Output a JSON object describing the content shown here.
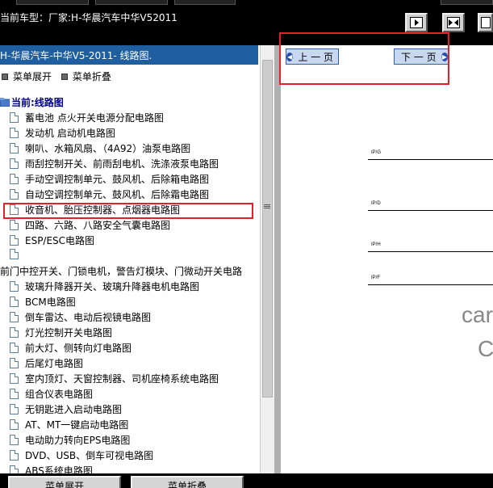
{
  "header": {
    "current_car": "当前车型：厂家:H-华晨汽车中华V52011"
  },
  "left_panel": {
    "title": "H-华晨汽车-中华V5-2011- 线路图.",
    "expand_label": "菜单展开",
    "collapse_label": "菜单折叠",
    "root_label": "当前:线路图",
    "items": [
      "蓄电池 点火开关电源分配电路图",
      "发动机 启动机电路图",
      "喇叭、水箱风扇、（4A92）油泵电路图",
      "雨刮控制开关、前雨刮电机、洗涤液泵电路图",
      "手动空调控制单元、鼓风机、后除箱电路图",
      "自动空调控制单元、鼓风机、后除霜电路图",
      "收音机、胎压控制器、点烟器电路图",
      "四路、六路、八路安全气囊电路图",
      "ESP/ESC电路图",
      "",
      "前门中控开关、门锁电机，警告灯模块、门微动开关电路",
      "玻璃升降器开关、玻璃升降器电机电路图",
      "BCM电路图",
      "倒车雷达、电动后视镜电路图",
      "灯光控制开关电路图",
      "前大灯、侧转向灯电路图",
      "后尾灯电路图",
      "室内顶灯、天窗控制器、司机座椅系统电路图",
      "组合仪表电路图",
      "无钥匙进入启动电路图",
      "AT、MT一键启动电路图",
      "电动助力转向EPS电路图",
      "DVD、USB、倒车可视电路图",
      "ABS系统电路图"
    ],
    "highlighted_index": 3
  },
  "right_panel": {
    "prev_label": "上 一 页",
    "next_label": "下 一 页",
    "pins": [
      "IP/G",
      "IP/D",
      "IP/H",
      "IP/F"
    ],
    "partial_text_1": "car",
    "partial_text_2": "C"
  },
  "bottom": {
    "btn1": "菜单展开",
    "btn2": "菜单折叠"
  },
  "colors": {
    "header_blue": "#1f5f9f",
    "highlight_red": "#e0202a",
    "root_text": "#00008b"
  }
}
